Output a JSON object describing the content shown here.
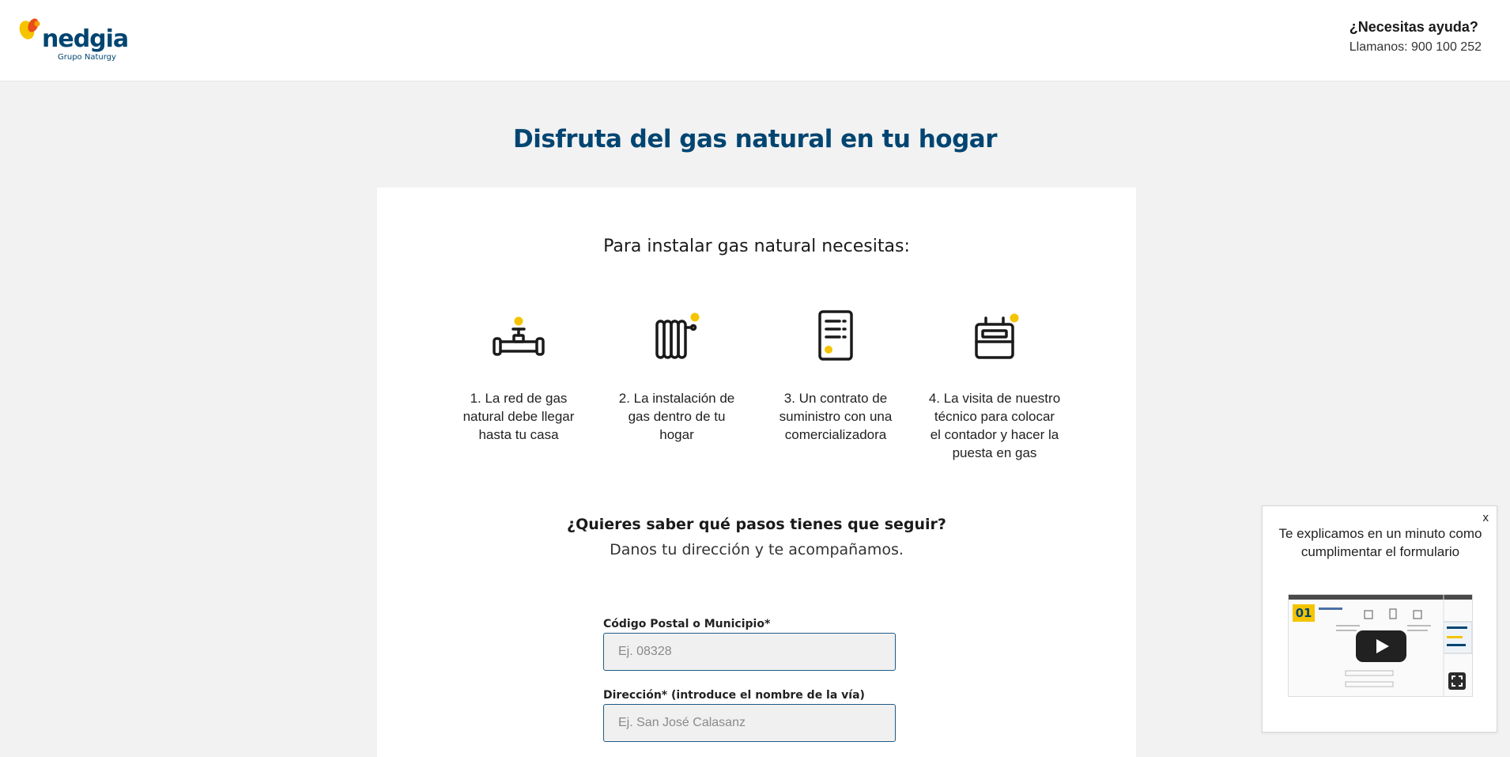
{
  "header": {
    "logo_text": "nedgia",
    "logo_subtext": "Grupo Naturgy",
    "help_title": "¿Necesitas ayuda?",
    "help_phone": "Llamanos: 900 100 252"
  },
  "hero": {
    "title": "Disfruta del gas natural en tu hogar"
  },
  "card": {
    "title": "Para instalar gas natural necesitas:",
    "steps": [
      {
        "label": "1. La red de gas natural debe llegar hasta tu casa",
        "icon": "gas-pipe-icon"
      },
      {
        "label": "2. La instalación de gas dentro de tu hogar",
        "icon": "radiator-icon"
      },
      {
        "label": "3. Un contrato de suministro con una comercializadora",
        "icon": "contract-document-icon"
      },
      {
        "label": "4. La visita de nuestro técnico para colocar el contador y hacer la puesta en gas",
        "icon": "gas-meter-icon"
      }
    ],
    "question_title": "¿Quieres saber qué pasos tienes que seguir?",
    "question_subtitle": "Danos tu dirección y te acompañamos."
  },
  "form": {
    "postal_label": "Código Postal o Municipio*",
    "postal_placeholder": "Ej. 08328",
    "address_label": "Dirección* (introduce el nombre de la vía)",
    "address_placeholder": "Ej. San José Calasanz"
  },
  "popup": {
    "close_label": "x",
    "text": "Te explicamos en un minuto como cumplimentar el formulario",
    "video_badge": "01"
  },
  "colors": {
    "brand_blue": "#004571",
    "accent_yellow": "#f5c400",
    "page_bg": "#f2f2f2"
  }
}
